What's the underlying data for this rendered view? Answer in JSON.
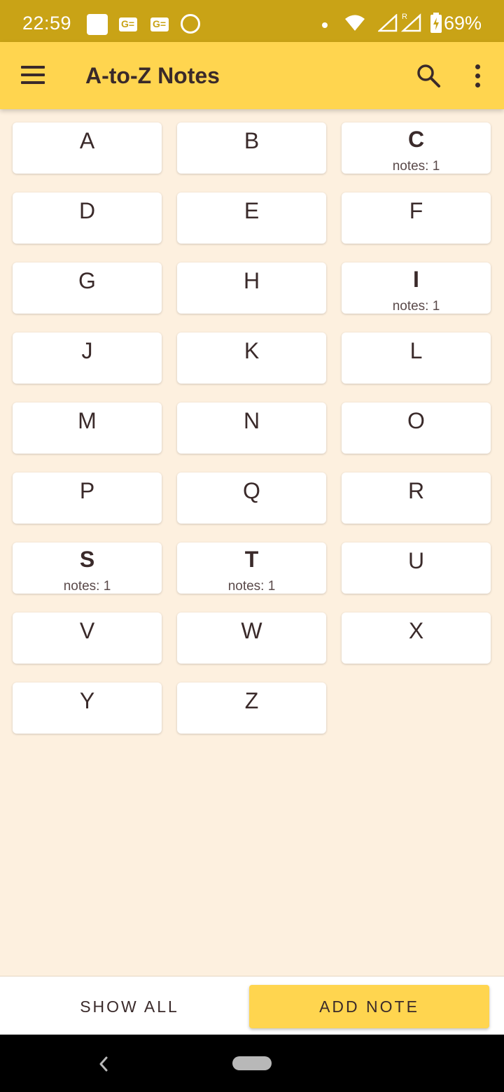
{
  "status_bar": {
    "time": "22:59",
    "battery": "69%",
    "icons": [
      "notification-square-icon",
      "gmail-icon",
      "gmail-icon",
      "circle-app-icon",
      "dot-icon",
      "wifi-icon",
      "signal-icon",
      "roaming-signal-icon",
      "battery-charging-icon"
    ]
  },
  "app_bar": {
    "title": "A-to-Z Notes",
    "icons": [
      "menu-icon",
      "search-icon",
      "more-vert-icon"
    ]
  },
  "tiles": [
    {
      "letter": "A",
      "count": ""
    },
    {
      "letter": "B",
      "count": ""
    },
    {
      "letter": "C",
      "count": "notes: 1"
    },
    {
      "letter": "D",
      "count": ""
    },
    {
      "letter": "E",
      "count": ""
    },
    {
      "letter": "F",
      "count": ""
    },
    {
      "letter": "G",
      "count": ""
    },
    {
      "letter": "H",
      "count": ""
    },
    {
      "letter": "I",
      "count": "notes: 1"
    },
    {
      "letter": "J",
      "count": ""
    },
    {
      "letter": "K",
      "count": ""
    },
    {
      "letter": "L",
      "count": ""
    },
    {
      "letter": "M",
      "count": ""
    },
    {
      "letter": "N",
      "count": ""
    },
    {
      "letter": "O",
      "count": ""
    },
    {
      "letter": "P",
      "count": ""
    },
    {
      "letter": "Q",
      "count": ""
    },
    {
      "letter": "R",
      "count": ""
    },
    {
      "letter": "S",
      "count": "notes: 1"
    },
    {
      "letter": "T",
      "count": "notes: 1"
    },
    {
      "letter": "U",
      "count": ""
    },
    {
      "letter": "V",
      "count": ""
    },
    {
      "letter": "W",
      "count": ""
    },
    {
      "letter": "X",
      "count": ""
    },
    {
      "letter": "Y",
      "count": ""
    },
    {
      "letter": "Z",
      "count": ""
    }
  ],
  "bottom_bar": {
    "show_all_label": "SHOW ALL",
    "add_note_label": "ADD NOTE"
  },
  "colors": {
    "status_bar": "#C9A316",
    "app_bar": "#FFD54F",
    "background": "#FDF0DF",
    "accent_button": "#FFD54F",
    "text": "#3A2A2A"
  }
}
